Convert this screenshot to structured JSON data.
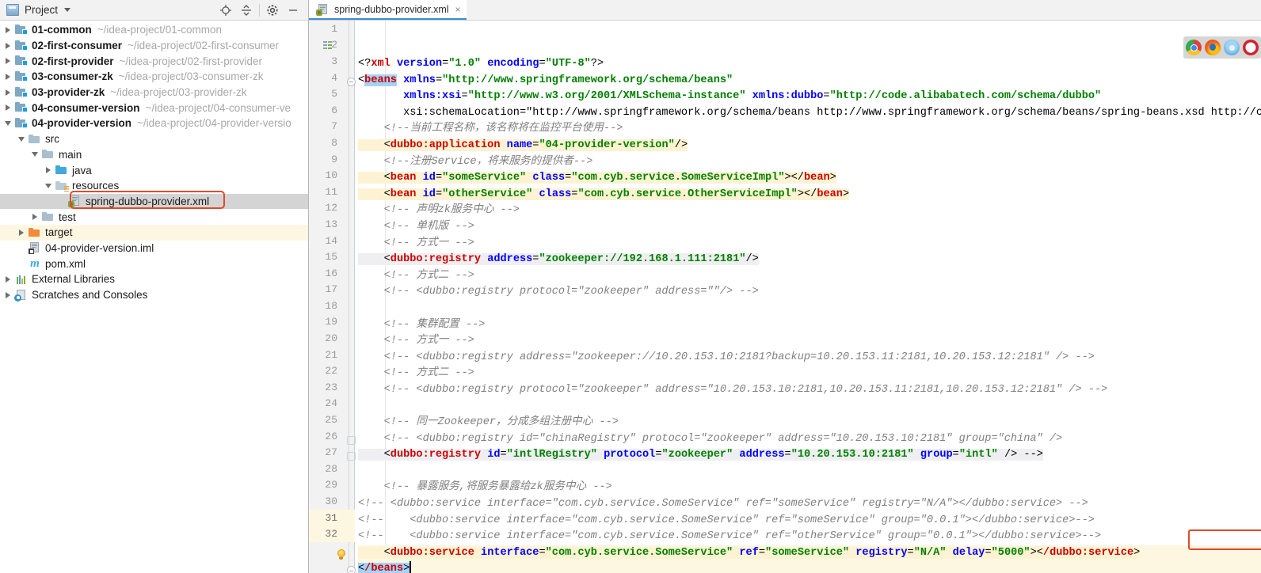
{
  "window": {
    "accent": "#3f8cd0",
    "highlight_box_color": "#e04b2a"
  },
  "sidebar": {
    "panel_title": "Project",
    "toolbar": [
      {
        "name": "locate-target-icon",
        "label": "Select Opened File"
      },
      {
        "name": "collapse-all-icon",
        "label": "Collapse All"
      },
      {
        "name": "gear-icon",
        "label": "Settings"
      },
      {
        "name": "minimize-icon",
        "label": "Hide"
      }
    ],
    "tree": [
      {
        "indent": 0,
        "twisty": "right",
        "icon": "module-icon",
        "name": "01-common",
        "path": "~/idea-project/01-common",
        "bold": true,
        "state": "normal"
      },
      {
        "indent": 0,
        "twisty": "right",
        "icon": "module-icon",
        "name": "02-first-consumer",
        "path": "~/idea-project/02-first-consumer",
        "bold": true,
        "state": "normal"
      },
      {
        "indent": 0,
        "twisty": "right",
        "icon": "module-icon",
        "name": "02-first-provider",
        "path": "~/idea-project/02-first-provider",
        "bold": true,
        "state": "normal"
      },
      {
        "indent": 0,
        "twisty": "right",
        "icon": "module-icon",
        "name": "03-consumer-zk",
        "path": "~/idea-project/03-consumer-zk",
        "bold": true,
        "state": "normal"
      },
      {
        "indent": 0,
        "twisty": "right",
        "icon": "module-icon",
        "name": "03-provider-zk",
        "path": "~/idea-project/03-provider-zk",
        "bold": true,
        "state": "normal"
      },
      {
        "indent": 0,
        "twisty": "right",
        "icon": "module-icon",
        "name": "04-consumer-version",
        "path": "~/idea-project/04-consumer-ve",
        "bold": true,
        "state": "normal"
      },
      {
        "indent": 0,
        "twisty": "down",
        "icon": "module-icon",
        "name": "04-provider-version",
        "path": "~/idea-project/04-provider-versio",
        "bold": true,
        "state": "normal"
      },
      {
        "indent": 1,
        "twisty": "down",
        "icon": "folder-icon",
        "name": "src",
        "path": "",
        "bold": false,
        "state": "normal"
      },
      {
        "indent": 2,
        "twisty": "down",
        "icon": "folder-icon",
        "name": "main",
        "path": "",
        "bold": false,
        "state": "normal"
      },
      {
        "indent": 3,
        "twisty": "right",
        "icon": "source-folder-icon",
        "name": "java",
        "path": "",
        "bold": false,
        "state": "normal"
      },
      {
        "indent": 3,
        "twisty": "down",
        "icon": "resources-folder-icon",
        "name": "resources",
        "path": "",
        "bold": false,
        "state": "normal"
      },
      {
        "indent": 4,
        "twisty": "none",
        "icon": "spring-xml-file-icon",
        "name": "spring-dubbo-provider.xml",
        "path": "",
        "bold": false,
        "state": "selected"
      },
      {
        "indent": 2,
        "twisty": "right",
        "icon": "folder-icon",
        "name": "test",
        "path": "",
        "bold": false,
        "state": "normal"
      },
      {
        "indent": 1,
        "twisty": "right",
        "icon": "target-folder-icon",
        "name": "target",
        "path": "",
        "bold": false,
        "state": "highlighted"
      },
      {
        "indent": 1,
        "twisty": "none",
        "icon": "iml-file-icon",
        "name": "04-provider-version.iml",
        "path": "",
        "bold": false,
        "state": "normal"
      },
      {
        "indent": 1,
        "twisty": "none",
        "icon": "maven-pom-icon",
        "name": "pom.xml",
        "path": "",
        "bold": false,
        "state": "normal"
      },
      {
        "indent": 0,
        "twisty": "right",
        "icon": "external-libraries-icon",
        "name": "External Libraries",
        "path": "",
        "bold": false,
        "state": "normal"
      },
      {
        "indent": 0,
        "twisty": "right",
        "icon": "scratches-icon",
        "name": "Scratches and Consoles",
        "path": "",
        "bold": false,
        "state": "normal"
      }
    ]
  },
  "editor": {
    "tab": {
      "label": "spring-dubbo-provider.xml",
      "icon": "spring-xml-file-icon",
      "close_label": "×",
      "active": true
    },
    "cursor_line": 32,
    "total_lines": 32,
    "inspection_widget": {
      "browsers": [
        {
          "name": "chrome-icon",
          "label": "Chrome"
        },
        {
          "name": "firefox-icon",
          "label": "Firefox"
        },
        {
          "name": "safari-icon",
          "label": "Safari"
        },
        {
          "name": "opera-icon",
          "label": "Opera"
        }
      ]
    },
    "gutter_markers": {
      "line2": "spring-beans-gutter-icon",
      "line24": "fold-brace-icon",
      "line25": "fold-brace-icon",
      "line31": "intention-bulb-icon",
      "line32": "fold-end-icon"
    },
    "lines": [
      {
        "n": 1,
        "text": "<?xml version=\"1.0\" encoding=\"UTF-8\"?>"
      },
      {
        "n": 2,
        "text": "<beans xmlns=\"http://www.springframework.org/schema/beans\""
      },
      {
        "n": 3,
        "text": "       xmlns:xsi=\"http://www.w3.org/2001/XMLSchema-instance\" xmlns:dubbo=\"http://code.alibabatech.com/schema/dubbo\""
      },
      {
        "n": 4,
        "text": "       xsi:schemaLocation=\"http://www.springframework.org/schema/beans http://www.springframework.org/schema/beans/spring-beans.xsd http://co"
      },
      {
        "n": 5,
        "text": "    <!--当前工程名称，该名称将在监控平台使用-->"
      },
      {
        "n": 6,
        "text": "    <dubbo:application name=\"04-provider-version\"/>"
      },
      {
        "n": 7,
        "text": "    <!--注册Service，将来服务的提供者-->"
      },
      {
        "n": 8,
        "text": "    <bean id=\"someService\" class=\"com.cyb.service.SomeServiceImpl\"></bean>"
      },
      {
        "n": 9,
        "text": "    <bean id=\"otherService\" class=\"com.cyb.service.OtherServiceImpl\"></bean>"
      },
      {
        "n": 10,
        "text": "    <!-- 声明zk服务中心 -->"
      },
      {
        "n": 11,
        "text": "    <!-- 单机版 -->"
      },
      {
        "n": 12,
        "text": "    <!-- 方式一 -->"
      },
      {
        "n": 13,
        "text": "    <dubbo:registry address=\"zookeeper://192.168.1.111:2181\"/>"
      },
      {
        "n": 14,
        "text": "    <!-- 方式二 -->"
      },
      {
        "n": 15,
        "text": "    <!-- <dubbo:registry protocol=\"zookeeper\" address=\"\"/> -->"
      },
      {
        "n": 16,
        "text": ""
      },
      {
        "n": 17,
        "text": "    <!-- 集群配置 -->"
      },
      {
        "n": 18,
        "text": "    <!-- 方式一 -->"
      },
      {
        "n": 19,
        "text": "    <!-- <dubbo:registry address=\"zookeeper://10.20.153.10:2181?backup=10.20.153.11:2181,10.20.153.12:2181\" /> -->"
      },
      {
        "n": 20,
        "text": "    <!-- 方式二 -->"
      },
      {
        "n": 21,
        "text": "    <!-- <dubbo:registry protocol=\"zookeeper\" address=\"10.20.153.10:2181,10.20.153.11:2181,10.20.153.12:2181\" /> -->"
      },
      {
        "n": 22,
        "text": ""
      },
      {
        "n": 23,
        "text": "    <!-- 同一Zookeeper，分成多组注册中心 -->"
      },
      {
        "n": 24,
        "text": "    <!-- <dubbo:registry id=\"chinaRegistry\" protocol=\"zookeeper\" address=\"10.20.153.10:2181\" group=\"china\" />"
      },
      {
        "n": 25,
        "text": "    <dubbo:registry id=\"intlRegistry\" protocol=\"zookeeper\" address=\"10.20.153.10:2181\" group=\"intl\" /> -->"
      },
      {
        "n": 26,
        "text": ""
      },
      {
        "n": 27,
        "text": "    <!-- 暴露服务,将服务暴露给zk服务中心 -->"
      },
      {
        "n": 28,
        "text": "<!-- <dubbo:service interface=\"com.cyb.service.SomeService\" ref=\"someService\" registry=\"N/A\"></dubbo:service> -->"
      },
      {
        "n": 29,
        "text": "<!--    <dubbo:service interface=\"com.cyb.service.SomeService\" ref=\"someService\" group=\"0.0.1\"></dubbo:service>-->"
      },
      {
        "n": 30,
        "text": "<!--    <dubbo:service interface=\"com.cyb.service.SomeService\" ref=\"otherService\" group=\"0.0.1\"></dubbo:service>-->"
      },
      {
        "n": 31,
        "text": "    <dubbo:service interface=\"com.cyb.service.SomeService\" ref=\"someService\" registry=\"N/A\" delay=\"5000\"></dubbo:service>"
      },
      {
        "n": 32,
        "text": "</beans>"
      }
    ],
    "annotation_highlight": "delay=\"5000\""
  }
}
